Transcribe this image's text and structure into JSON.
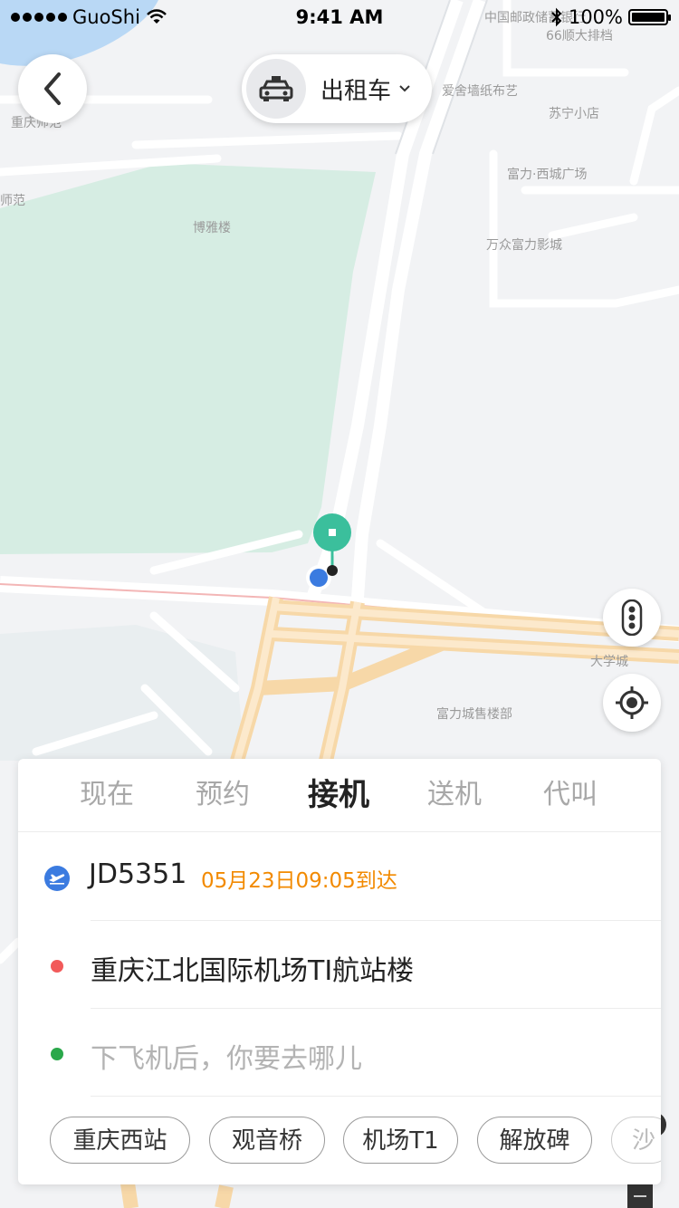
{
  "status_bar": {
    "carrier": "GuoShi",
    "time": "9:41 AM",
    "battery": "100%"
  },
  "header": {
    "service_label": "出租车"
  },
  "map": {
    "labels": [
      "中国邮政储蓄银行",
      "66顺大排档",
      "爱舍墙纸布艺",
      "苏宁小店",
      "重庆师范",
      "师范",
      "富力·西城广场",
      "博雅楼",
      "万众富力影城",
      "大学城",
      "富力城售楼部"
    ]
  },
  "tabs": [
    {
      "label": "现在"
    },
    {
      "label": "预约"
    },
    {
      "label": "接机",
      "active": true
    },
    {
      "label": "送机"
    },
    {
      "label": "代叫"
    }
  ],
  "flight": {
    "number": "JD5351",
    "arrival": "05月23日09:05到达"
  },
  "pickup": {
    "address": "重庆江北国际机场TI航站楼"
  },
  "destination": {
    "placeholder": "下飞机后，你要去哪儿"
  },
  "chips": [
    "重庆西站",
    "观音桥",
    "机场T1",
    "解放碑",
    "沙"
  ],
  "colors": {
    "accent_orange": "#f28a00",
    "pin_green": "#3bbf9c",
    "dot_red": "#f25a5a",
    "dot_green": "#2aa84a",
    "plane_blue": "#3b7be0"
  }
}
